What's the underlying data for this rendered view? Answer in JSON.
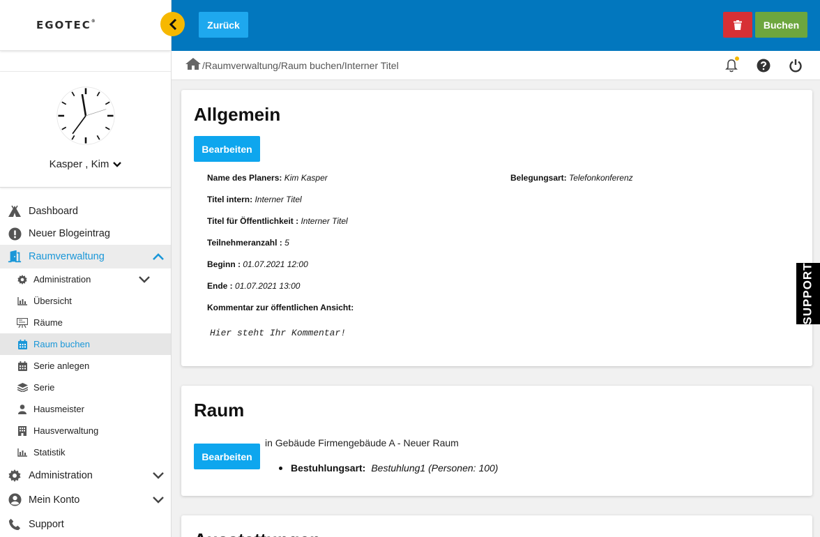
{
  "logo": {
    "text": "EGOTEC",
    "mark": "®"
  },
  "user": {
    "name": "Kasper , Kim"
  },
  "nav": {
    "dashboard": "Dashboard",
    "blog": "Neuer Blogeintrag",
    "raumverwaltung": "Raumverwaltung",
    "sub": {
      "administration": "Administration",
      "uebersicht": "Übersicht",
      "raeume": "Räume",
      "raum_buchen": "Raum buchen",
      "serie_anlegen": "Serie anlegen",
      "serie": "Serie",
      "hausmeister": "Hausmeister",
      "hausverwaltung": "Hausverwaltung",
      "statistik": "Statistik"
    },
    "administration": "Administration",
    "mein_konto": "Mein Konto",
    "support": "Support"
  },
  "toolbar": {
    "back_label": "Zurück",
    "book_label": "Buchen"
  },
  "breadcrumb": "/Raumverwaltung/Raum buchen/Interner Titel",
  "allgemein": {
    "title": "Allgemein",
    "edit_label": "Bearbeiten",
    "fields": {
      "planer_label": "Name des Planers:",
      "planer_value": "Kim Kasper",
      "belegung_label": "Belegungsart:",
      "belegung_value": "Telefonkonferenz",
      "titel_intern_label": "Titel intern:",
      "titel_intern_value": "Interner Titel",
      "titel_oeff_label": "Titel für Öffentlichkeit :",
      "titel_oeff_value": "Interner Titel",
      "teilnehmer_label": "Teilnehmeranzahl :",
      "teilnehmer_value": "5",
      "beginn_label": "Beginn :",
      "beginn_value": "01.07.2021 12:00",
      "ende_label": "Ende :",
      "ende_value": "01.07.2021 13:00",
      "kommentar_label": "Kommentar zur öffentlichen Ansicht:"
    },
    "comment": "Hier steht Ihr Kommentar!"
  },
  "raum": {
    "title": "Raum",
    "edit_label": "Bearbeiten",
    "location": "in Gebäude Firmengebäude A - Neuer Raum",
    "seating_label": "Bestuhlungsart:",
    "seating_value": "Bestuhlung1 (Personen: 100)"
  },
  "ausstattungen": {
    "title": "Ausstattungen"
  },
  "support_tab": "SUPPORT",
  "colors": {
    "topbar": "#0277be",
    "accent": "#1a97d8",
    "collapse": "#f6b800",
    "delete": "#d73035",
    "book": "#6da63e",
    "edit": "#0ea6ee"
  }
}
